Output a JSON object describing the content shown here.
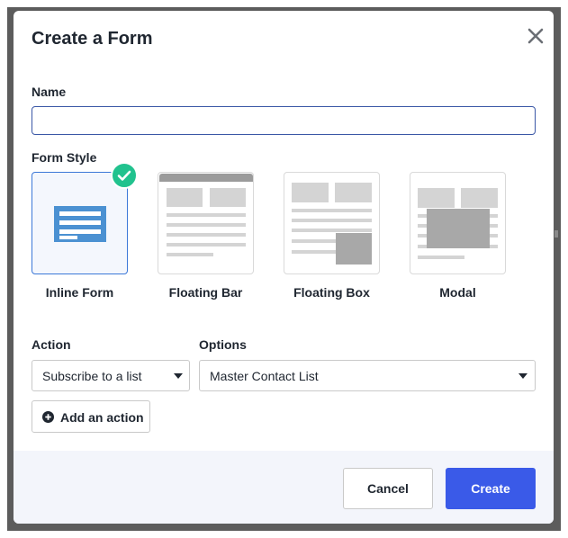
{
  "dialog": {
    "title": "Create a Form"
  },
  "name_field": {
    "label": "Name",
    "value": "",
    "placeholder": ""
  },
  "form_style": {
    "label": "Form Style",
    "selected": "Inline Form",
    "options": [
      {
        "label": "Inline Form",
        "icon": "inline-form-icon"
      },
      {
        "label": "Floating Bar",
        "icon": "floating-bar-icon"
      },
      {
        "label": "Floating Box",
        "icon": "floating-box-icon"
      },
      {
        "label": "Modal",
        "icon": "modal-icon"
      }
    ]
  },
  "action": {
    "label": "Action",
    "value": "Subscribe to a list"
  },
  "options_field": {
    "label": "Options",
    "value": "Master Contact List"
  },
  "add_action": {
    "label": "Add an action",
    "icon": "plus-circle-icon"
  },
  "footer": {
    "cancel_label": "Cancel",
    "create_label": "Create"
  },
  "colors": {
    "accent": "#3a5ae8",
    "check_badge": "#21c28e",
    "selected_border": "#3c78d8",
    "inline_icon": "#4b91d2",
    "footer_bg": "#f3f5fb"
  }
}
